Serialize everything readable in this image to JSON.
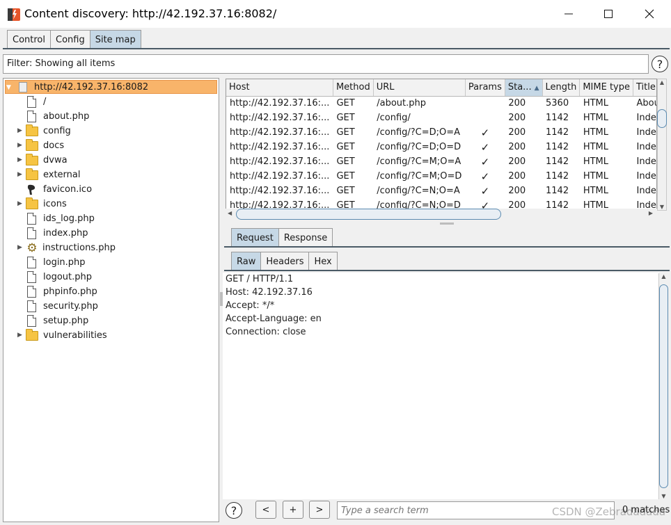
{
  "window": {
    "title": "Content discovery: http://42.192.37.16:8082/"
  },
  "main_tabs": [
    {
      "label": "Control"
    },
    {
      "label": "Config"
    },
    {
      "label": "Site map"
    }
  ],
  "filter": {
    "text": "Filter: Showing all items"
  },
  "help_glyph": "?",
  "tree": {
    "root": {
      "label": "http://42.192.37.16:8082"
    },
    "items": [
      {
        "label": "/",
        "icon": "document-icon",
        "expandable": false
      },
      {
        "label": "about.php",
        "icon": "document-icon",
        "expandable": false
      },
      {
        "label": "config",
        "icon": "folder-icon",
        "expandable": true
      },
      {
        "label": "docs",
        "icon": "folder-icon",
        "expandable": true
      },
      {
        "label": "dvwa",
        "icon": "folder-icon",
        "expandable": true
      },
      {
        "label": "external",
        "icon": "folder-icon",
        "expandable": true
      },
      {
        "label": "favicon.ico",
        "icon": "favicon-icon",
        "expandable": false
      },
      {
        "label": "icons",
        "icon": "folder-icon",
        "expandable": true
      },
      {
        "label": "ids_log.php",
        "icon": "document-icon",
        "expandable": false
      },
      {
        "label": "index.php",
        "icon": "document-icon",
        "expandable": false
      },
      {
        "label": "instructions.php",
        "icon": "gear-icon",
        "expandable": true
      },
      {
        "label": "login.php",
        "icon": "document-icon",
        "expandable": false
      },
      {
        "label": "logout.php",
        "icon": "document-icon",
        "expandable": false
      },
      {
        "label": "phpinfo.php",
        "icon": "document-icon",
        "expandable": false
      },
      {
        "label": "security.php",
        "icon": "document-icon",
        "expandable": false
      },
      {
        "label": "setup.php",
        "icon": "document-icon",
        "expandable": false
      },
      {
        "label": "vulnerabilities",
        "icon": "folder-icon",
        "expandable": true
      }
    ]
  },
  "table": {
    "columns": [
      "Host",
      "Method",
      "URL",
      "Params",
      "Sta...",
      "Length",
      "MIME type",
      "Title"
    ],
    "sorted_column": "Sta...",
    "rows": [
      [
        "http://42.192.37.16:...",
        "GET",
        "/about.php",
        "",
        "200",
        "5360",
        "HTML",
        "Abou"
      ],
      [
        "http://42.192.37.16:...",
        "GET",
        "/config/",
        "",
        "200",
        "1142",
        "HTML",
        "Inde"
      ],
      [
        "http://42.192.37.16:...",
        "GET",
        "/config/?C=D;O=A",
        "✓",
        "200",
        "1142",
        "HTML",
        "Inde"
      ],
      [
        "http://42.192.37.16:...",
        "GET",
        "/config/?C=D;O=D",
        "✓",
        "200",
        "1142",
        "HTML",
        "Inde"
      ],
      [
        "http://42.192.37.16:...",
        "GET",
        "/config/?C=M;O=A",
        "✓",
        "200",
        "1142",
        "HTML",
        "Inde"
      ],
      [
        "http://42.192.37.16:...",
        "GET",
        "/config/?C=M;O=D",
        "✓",
        "200",
        "1142",
        "HTML",
        "Inde"
      ],
      [
        "http://42.192.37.16:...",
        "GET",
        "/config/?C=N;O=A",
        "✓",
        "200",
        "1142",
        "HTML",
        "Inde"
      ],
      [
        "http://42.192.37.16:...",
        "GET",
        "/config/?C=N;O=D",
        "✓",
        "200",
        "1142",
        "HTML",
        "Inde"
      ]
    ]
  },
  "request_tabs": [
    {
      "label": "Request"
    },
    {
      "label": "Response"
    }
  ],
  "view_tabs": [
    {
      "label": "Raw"
    },
    {
      "label": "Headers"
    },
    {
      "label": "Hex"
    }
  ],
  "raw_request": [
    "GET / HTTP/1.1",
    "Host: 42.192.37.16",
    "Accept: */*",
    "Accept-Language: en",
    "Connection: close"
  ],
  "bottom": {
    "prev_label": "<",
    "add_label": "+",
    "next_label": ">",
    "search_placeholder": "Type a search term",
    "matches": "0 matches"
  },
  "watermark": "CSDN @Zebradadada",
  "colors": {
    "selected_tree_row": "#f8b46a",
    "active_tab": "#c6d8e6",
    "tab_underline": "#4a5a66",
    "folder": "#f6c443",
    "app_logo": "#e8562a"
  }
}
